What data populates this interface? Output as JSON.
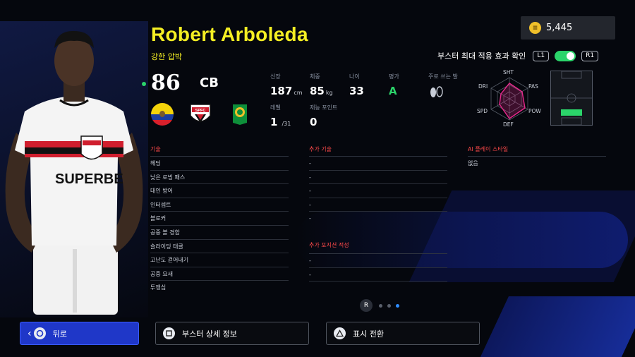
{
  "player": {
    "name": "Robert Arboleda",
    "playstyle": "강한 압박",
    "overall": "86",
    "position": "CB"
  },
  "coins": {
    "value": "5,445",
    "icon": "coin-icon"
  },
  "booster": {
    "label": "부스터 최대 적용 효과 확인",
    "l1": "L1",
    "r1": "R1",
    "toggle_on": true
  },
  "club_badge_text": "SPFC",
  "stats": {
    "height": {
      "label": "신장",
      "value": "187",
      "unit": "cm"
    },
    "weight": {
      "label": "체중",
      "value": "85",
      "unit": "kg"
    },
    "age": {
      "label": "나이",
      "value": "33"
    },
    "rating": {
      "label": "평가",
      "value": "A"
    },
    "foot": {
      "label": "주로 쓰는 발",
      "icon": "foot-icon"
    },
    "level": {
      "label": "레벨",
      "value": "1",
      "max": "/31"
    },
    "skill_points": {
      "label": "재능 포인트",
      "value": "0"
    }
  },
  "radar": {
    "labels": [
      "SHT",
      "PAS",
      "POW",
      "DEF",
      "SPD",
      "DRI"
    ]
  },
  "skills": {
    "header": "기술",
    "items": [
      "헤딩",
      "낮은 로빙 패스",
      "대인 방어",
      "인터셉트",
      "블로커",
      "공중 볼 경합",
      "슬라이딩 태클",
      "고난도 걷어내기",
      "공중 요새",
      "투쟁심"
    ]
  },
  "extra_skills": {
    "header": "추가 기술",
    "items": [
      "-",
      "-",
      "-",
      "-",
      "-"
    ]
  },
  "extra_positions": {
    "header": "추가 포지션 적성",
    "items": [
      "-",
      "-"
    ]
  },
  "ai_style": {
    "header": "AI 플레이 스타일",
    "items": [
      "없음"
    ]
  },
  "pager": {
    "label": "R"
  },
  "buttons": {
    "back": "뒤로",
    "booster_detail": "부스터 상세 정보",
    "view_toggle": "표시 전환"
  },
  "colors": {
    "accent": "#f5ef23",
    "red_header": "#ff4a4a",
    "green": "#2bd46a",
    "back_button": "#1f37c8"
  }
}
